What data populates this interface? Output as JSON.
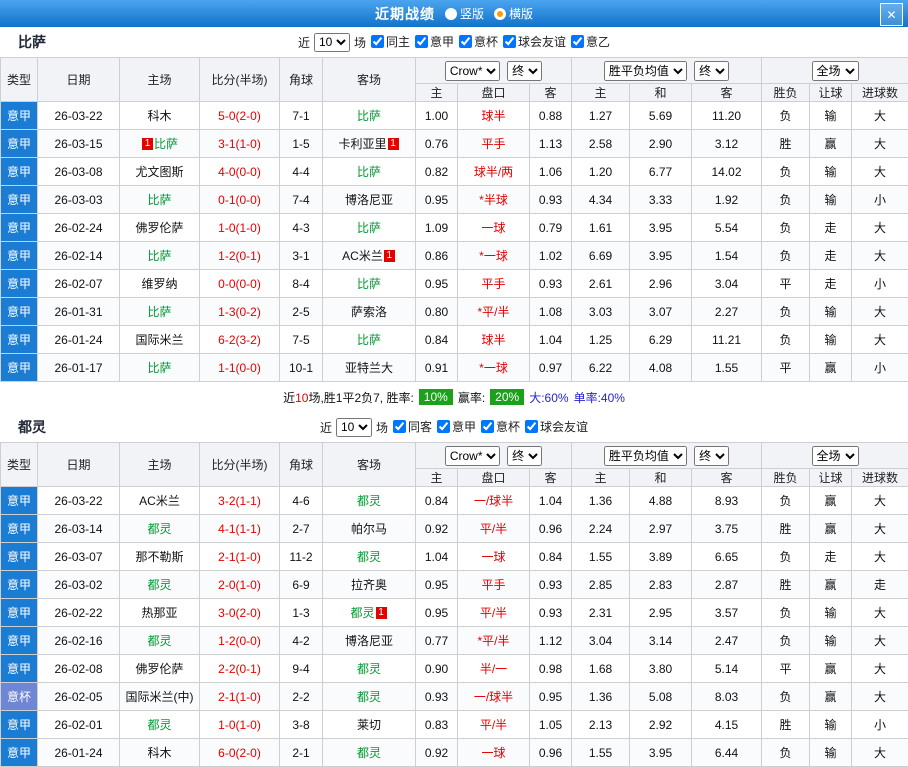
{
  "titlebar": {
    "title": "近期战绩",
    "radios": [
      {
        "label": "竖版",
        "checked": false
      },
      {
        "label": "横版",
        "checked": true
      }
    ],
    "close_label": "✕"
  },
  "filter_labels": {
    "near": "近",
    "matches": "场"
  },
  "table_head": {
    "type": "类型",
    "date": "日期",
    "home": "主场",
    "score": "比分(半场)",
    "corner": "角球",
    "away": "客场",
    "select_bookmaker": "Crow*",
    "select_final_1": "终",
    "select_avg": "胜平负均值",
    "select_final_2": "终",
    "select_scope": "全场",
    "sub_home": "主",
    "sub_handicap": "盘口",
    "sub_away": "客",
    "sub_avg_home": "主",
    "sub_avg_draw": "和",
    "sub_avg_away": "客",
    "sub_result": "胜负",
    "sub_handicap_result": "让球",
    "sub_goals": "进球数"
  },
  "colors": {
    "league": "#1b7cd4",
    "cup": "#6e86d5",
    "team": "#009933",
    "red": "#e60000",
    "blue": "#2525cd",
    "green": "#009933",
    "badge": "#1ba11b"
  },
  "sections": [
    {
      "team": "比萨",
      "filter_count": "10",
      "filter_checks": [
        {
          "label": "同主",
          "checked": true
        },
        {
          "label": "意甲",
          "checked": true
        },
        {
          "label": "意杯",
          "checked": true
        },
        {
          "label": "球会友谊",
          "checked": true
        },
        {
          "label": "意乙",
          "checked": true
        }
      ],
      "rows": [
        {
          "t": "意甲",
          "d": "26-03-22",
          "h": "科木",
          "s": "5-0(2-0)",
          "c": "7-1",
          "a": "比萨",
          "ag": true,
          "o1": "1.00",
          "hc": "球半",
          "o2": "0.88",
          "m1": "1.27",
          "m2": "5.69",
          "m3": "11.20",
          "r": "负",
          "lr": "输",
          "g": "大"
        },
        {
          "t": "意甲",
          "d": "26-03-15",
          "h": "比萨",
          "hg": true,
          "hpre": "1",
          "s": "3-1(1-0)",
          "c": "1-5",
          "a": "卡利亚里",
          "ab": "1",
          "o1": "0.76",
          "hc": "平手",
          "o2": "1.13",
          "m1": "2.58",
          "m2": "2.90",
          "m3": "3.12",
          "r": "胜",
          "lr": "赢",
          "g": "大"
        },
        {
          "t": "意甲",
          "d": "26-03-08",
          "h": "尤文图斯",
          "s": "4-0(0-0)",
          "c": "4-4",
          "a": "比萨",
          "ag": true,
          "o1": "0.82",
          "hc": "球半/两",
          "o2": "1.06",
          "m1": "1.20",
          "m2": "6.77",
          "m3": "14.02",
          "r": "负",
          "lr": "输",
          "g": "大"
        },
        {
          "t": "意甲",
          "d": "26-03-03",
          "h": "比萨",
          "hg": true,
          "s": "0-1(0-0)",
          "c": "7-4",
          "a": "博洛尼亚",
          "o1": "0.95",
          "hc": "*半球",
          "o2": "0.93",
          "m1": "4.34",
          "m2": "3.33",
          "m3": "1.92",
          "r": "负",
          "lr": "输",
          "g": "小"
        },
        {
          "t": "意甲",
          "d": "26-02-24",
          "h": "佛罗伦萨",
          "s": "1-0(1-0)",
          "c": "4-3",
          "a": "比萨",
          "ag": true,
          "o1": "1.09",
          "hc": "一球",
          "o2": "0.79",
          "m1": "1.61",
          "m2": "3.95",
          "m3": "5.54",
          "r": "负",
          "lr": "走",
          "g": "大"
        },
        {
          "t": "意甲",
          "d": "26-02-14",
          "h": "比萨",
          "hg": true,
          "s": "1-2(0-1)",
          "c": "3-1",
          "a": "AC米兰",
          "ab": "1",
          "o1": "0.86",
          "hc": "*一球",
          "o2": "1.02",
          "m1": "6.69",
          "m2": "3.95",
          "m3": "1.54",
          "r": "负",
          "lr": "走",
          "g": "大"
        },
        {
          "t": "意甲",
          "d": "26-02-07",
          "h": "维罗纳",
          "s": "0-0(0-0)",
          "c": "8-4",
          "a": "比萨",
          "ag": true,
          "o1": "0.95",
          "hc": "平手",
          "o2": "0.93",
          "m1": "2.61",
          "m2": "2.96",
          "m3": "3.04",
          "r": "平",
          "lr": "走",
          "g": "小"
        },
        {
          "t": "意甲",
          "d": "26-01-31",
          "h": "比萨",
          "hg": true,
          "s": "1-3(0-2)",
          "c": "2-5",
          "a": "萨索洛",
          "o1": "0.80",
          "hc": "*平/半",
          "o2": "1.08",
          "m1": "3.03",
          "m2": "3.07",
          "m3": "2.27",
          "r": "负",
          "lr": "输",
          "g": "大"
        },
        {
          "t": "意甲",
          "d": "26-01-24",
          "h": "国际米兰",
          "s": "6-2(3-2)",
          "c": "7-5",
          "a": "比萨",
          "ag": true,
          "o1": "0.84",
          "hc": "球半",
          "o2": "1.04",
          "m1": "1.25",
          "m2": "6.29",
          "m3": "11.21",
          "r": "负",
          "lr": "输",
          "g": "大"
        },
        {
          "t": "意甲",
          "d": "26-01-17",
          "h": "比萨",
          "hg": true,
          "s": "1-1(0-0)",
          "c": "10-1",
          "a": "亚特兰大",
          "o1": "0.91",
          "hc": "*一球",
          "o2": "0.97",
          "m1": "6.22",
          "m2": "4.08",
          "m3": "1.55",
          "r": "平",
          "lr": "赢",
          "g": "小"
        }
      ],
      "summary": {
        "lead_pre": "近",
        "lead_num": "10",
        "lead_post": "场,胜1平2负7, 胜率:",
        "rate_value": "10%",
        "win_label": "赢率:",
        "win_value": "20%",
        "big_stat": "大:60%",
        "single_stat": "单率:40%"
      }
    },
    {
      "team": "都灵",
      "filter_count": "10",
      "filter_checks": [
        {
          "label": "同客",
          "checked": true
        },
        {
          "label": "意甲",
          "checked": true
        },
        {
          "label": "意杯",
          "checked": true
        },
        {
          "label": "球会友谊",
          "checked": true
        }
      ],
      "rows": [
        {
          "t": "意甲",
          "d": "26-03-22",
          "h": "AC米兰",
          "s": "3-2(1-1)",
          "c": "4-6",
          "a": "都灵",
          "ag": true,
          "o1": "0.84",
          "hc": "一/球半",
          "o2": "1.04",
          "m1": "1.36",
          "m2": "4.88",
          "m3": "8.93",
          "r": "负",
          "lr": "赢",
          "g": "大"
        },
        {
          "t": "意甲",
          "d": "26-03-14",
          "h": "都灵",
          "hg": true,
          "s": "4-1(1-1)",
          "c": "2-7",
          "a": "帕尔马",
          "o1": "0.92",
          "hc": "平/半",
          "o2": "0.96",
          "m1": "2.24",
          "m2": "2.97",
          "m3": "3.75",
          "r": "胜",
          "lr": "赢",
          "g": "大"
        },
        {
          "t": "意甲",
          "d": "26-03-07",
          "h": "那不勒斯",
          "s": "2-1(1-0)",
          "c": "11-2",
          "a": "都灵",
          "ag": true,
          "o1": "1.04",
          "hc": "一球",
          "o2": "0.84",
          "m1": "1.55",
          "m2": "3.89",
          "m3": "6.65",
          "r": "负",
          "lr": "走",
          "g": "大"
        },
        {
          "t": "意甲",
          "d": "26-03-02",
          "h": "都灵",
          "hg": true,
          "s": "2-0(1-0)",
          "c": "6-9",
          "a": "拉齐奥",
          "o1": "0.95",
          "hc": "平手",
          "o2": "0.93",
          "m1": "2.85",
          "m2": "2.83",
          "m3": "2.87",
          "r": "胜",
          "lr": "赢",
          "g": "走"
        },
        {
          "t": "意甲",
          "d": "26-02-22",
          "h": "热那亚",
          "s": "3-0(2-0)",
          "c": "1-3",
          "a": "都灵",
          "ag": true,
          "ab": "1",
          "o1": "0.95",
          "hc": "平/半",
          "o2": "0.93",
          "m1": "2.31",
          "m2": "2.95",
          "m3": "3.57",
          "r": "负",
          "lr": "输",
          "g": "大"
        },
        {
          "t": "意甲",
          "d": "26-02-16",
          "h": "都灵",
          "hg": true,
          "s": "1-2(0-0)",
          "c": "4-2",
          "a": "博洛尼亚",
          "o1": "0.77",
          "hc": "*平/半",
          "o2": "1.12",
          "m1": "3.04",
          "m2": "3.14",
          "m3": "2.47",
          "r": "负",
          "lr": "输",
          "g": "大"
        },
        {
          "t": "意甲",
          "d": "26-02-08",
          "h": "佛罗伦萨",
          "s": "2-2(0-1)",
          "c": "9-4",
          "a": "都灵",
          "ag": true,
          "o1": "0.90",
          "hc": "半/一",
          "o2": "0.98",
          "m1": "1.68",
          "m2": "3.80",
          "m3": "5.14",
          "r": "平",
          "lr": "赢",
          "g": "大"
        },
        {
          "t": "意杯",
          "d": "26-02-05",
          "h": "国际米兰(中)",
          "s": "2-1(1-0)",
          "c": "2-2",
          "a": "都灵",
          "ag": true,
          "o1": "0.93",
          "hc": "一/球半",
          "o2": "0.95",
          "m1": "1.36",
          "m2": "5.08",
          "m3": "8.03",
          "r": "负",
          "lr": "赢",
          "g": "大"
        },
        {
          "t": "意甲",
          "d": "26-02-01",
          "h": "都灵",
          "hg": true,
          "s": "1-0(1-0)",
          "c": "3-8",
          "a": "莱切",
          "o1": "0.83",
          "hc": "平/半",
          "o2": "1.05",
          "m1": "2.13",
          "m2": "2.92",
          "m3": "4.15",
          "r": "胜",
          "lr": "输",
          "g": "小"
        },
        {
          "t": "意甲",
          "d": "26-01-24",
          "h": "科木",
          "s": "6-0(2-0)",
          "c": "2-1",
          "a": "都灵",
          "ag": true,
          "o1": "0.92",
          "hc": "一球",
          "o2": "0.96",
          "m1": "1.55",
          "m2": "3.95",
          "m3": "6.44",
          "r": "负",
          "lr": "输",
          "g": "大"
        }
      ]
    }
  ]
}
